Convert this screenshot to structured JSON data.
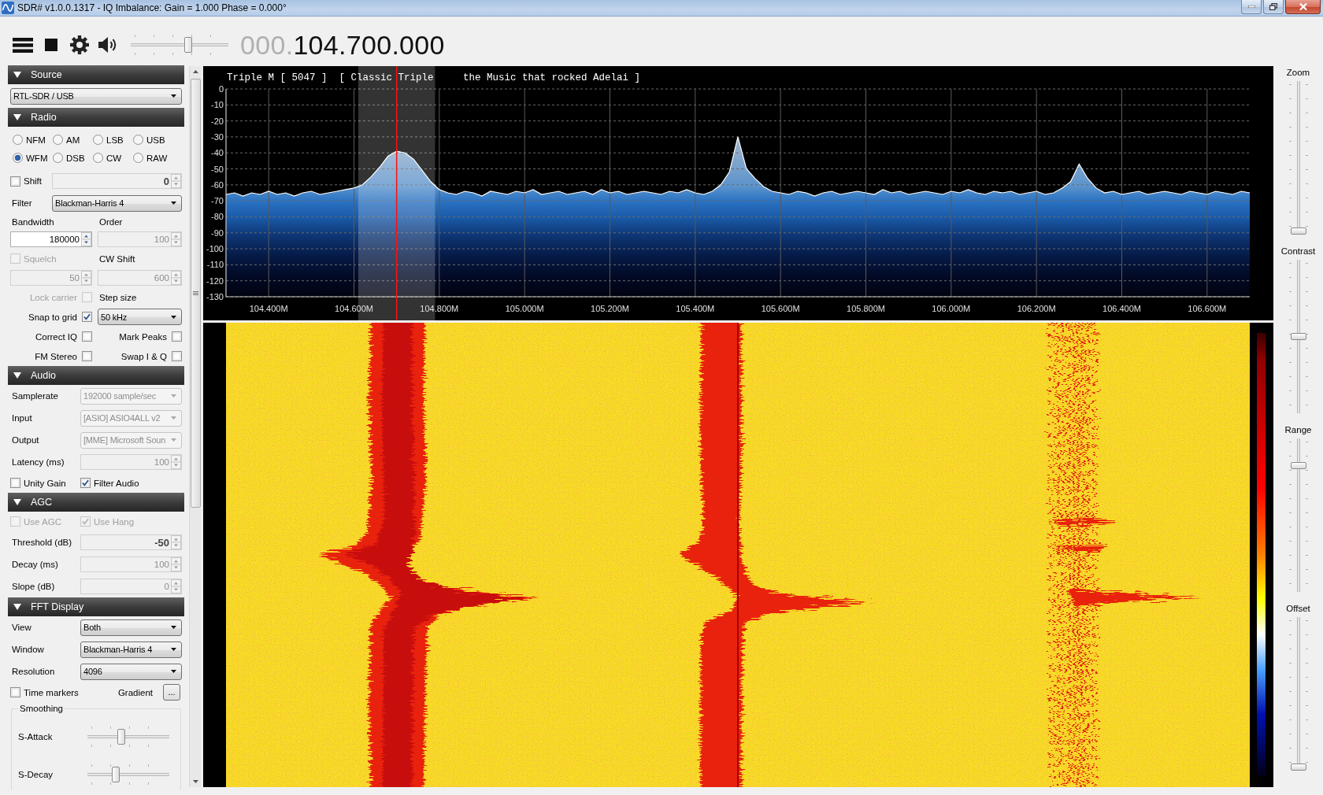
{
  "window": {
    "title": "SDR# v1.0.0.1317 - IQ Imbalance: Gain = 1.000 Phase = 0.000°"
  },
  "toolbar": {
    "volume": {
      "level": 0.6
    },
    "frequency": {
      "inactive_digits": "000.",
      "digits": "104.700.000"
    }
  },
  "panels": [
    {
      "title": "Source",
      "expanded": true,
      "rows": [
        {
          "kind": "dropdown",
          "value": "RTL-SDR / USB",
          "disabled": false
        }
      ]
    },
    {
      "title": "Radio",
      "expanded": true,
      "rows": [
        {
          "kind": "radios",
          "options": [
            {
              "label": "NFM",
              "selected": false
            },
            {
              "label": "AM",
              "selected": false
            },
            {
              "label": "LSB",
              "selected": false
            },
            {
              "label": "USB",
              "selected": false
            },
            {
              "label": "WFM",
              "selected": true
            },
            {
              "label": "DSB",
              "selected": false
            },
            {
              "label": "CW",
              "selected": false
            },
            {
              "label": "RAW",
              "selected": false
            }
          ]
        },
        {
          "kind": "field",
          "lead": {
            "kind": "checkbox",
            "label": "Shift",
            "checked": false,
            "disabled": false
          },
          "field": {
            "kind": "spinner",
            "value": "0",
            "bold": true,
            "disabled": true
          }
        },
        {
          "kind": "field",
          "lead": {
            "kind": "label",
            "text": "Filter"
          },
          "field": {
            "kind": "dropdown",
            "value": "Blackman-Harris 4",
            "disabled": false
          }
        },
        {
          "kind": "pair",
          "cells": [
            {
              "kind": "label",
              "text": "Bandwidth"
            },
            {
              "kind": "label",
              "text": "Order"
            }
          ]
        },
        {
          "kind": "pair",
          "cells": [
            {
              "kind": "spinner",
              "value": "180000",
              "bold": false,
              "disabled": false
            },
            {
              "kind": "spinner",
              "value": "100",
              "bold": false,
              "disabled": true
            }
          ]
        },
        {
          "kind": "pair",
          "cells": [
            {
              "kind": "checkbox",
              "label": "Squelch",
              "checked": false,
              "disabled": true
            },
            {
              "kind": "label",
              "text": "CW Shift"
            }
          ]
        },
        {
          "kind": "pair",
          "cells": [
            {
              "kind": "spinner",
              "value": "50",
              "bold": false,
              "disabled": true
            },
            {
              "kind": "spinner",
              "value": "600",
              "bold": false,
              "disabled": true
            }
          ]
        },
        {
          "kind": "pair",
          "cells": [
            {
              "kind": "checkbox_right",
              "label": "Lock carrier",
              "checked": false,
              "disabled": true
            },
            {
              "kind": "label",
              "text": "Step size"
            }
          ]
        },
        {
          "kind": "pair",
          "cells": [
            {
              "kind": "checkbox_right",
              "label": "Snap to grid",
              "checked": true,
              "disabled": false
            },
            {
              "kind": "dropdown",
              "value": "50 kHz",
              "disabled": false
            }
          ]
        },
        {
          "kind": "pair",
          "cells": [
            {
              "kind": "checkbox_right",
              "label": "Correct IQ",
              "checked": false,
              "disabled": false
            },
            {
              "kind": "checkbox_right",
              "label": "Mark Peaks",
              "checked": false,
              "disabled": false
            }
          ]
        },
        {
          "kind": "pair",
          "cells": [
            {
              "kind": "checkbox_right",
              "label": "FM Stereo",
              "checked": false,
              "disabled": false
            },
            {
              "kind": "checkbox_right",
              "label": "Swap I & Q",
              "checked": false,
              "disabled": false
            }
          ]
        }
      ]
    },
    {
      "title": "Audio",
      "expanded": true,
      "rows": [
        {
          "kind": "field",
          "lead": {
            "kind": "label",
            "text": "Samplerate"
          },
          "field": {
            "kind": "dropdown",
            "value": "192000 sample/sec",
            "disabled": true
          }
        },
        {
          "kind": "field",
          "lead": {
            "kind": "label",
            "text": "Input"
          },
          "field": {
            "kind": "dropdown",
            "value": "[ASIO] ASIO4ALL v2",
            "disabled": true
          }
        },
        {
          "kind": "field",
          "lead": {
            "kind": "label",
            "text": "Output"
          },
          "field": {
            "kind": "dropdown",
            "value": "[MME] Microsoft Soun",
            "disabled": true
          }
        },
        {
          "kind": "field",
          "lead": {
            "kind": "label",
            "text": "Latency (ms)"
          },
          "field": {
            "kind": "spinner",
            "value": "100",
            "bold": false,
            "disabled": true
          }
        },
        {
          "kind": "pair",
          "cells": [
            {
              "kind": "checkbox",
              "label": "Unity Gain",
              "checked": false,
              "disabled": false
            },
            {
              "kind": "checkbox",
              "label": "Filter Audio",
              "checked": true,
              "disabled": false
            }
          ]
        }
      ]
    },
    {
      "title": "AGC",
      "expanded": true,
      "rows": [
        {
          "kind": "pair",
          "cells": [
            {
              "kind": "checkbox",
              "label": "Use AGC",
              "checked": false,
              "disabled": true
            },
            {
              "kind": "checkbox",
              "label": "Use Hang",
              "checked": true,
              "disabled": true
            }
          ]
        },
        {
          "kind": "field",
          "lead": {
            "kind": "label",
            "text": "Threshold (dB)"
          },
          "field": {
            "kind": "spinner",
            "value": "-50",
            "bold": true,
            "disabled": true
          }
        },
        {
          "kind": "field",
          "lead": {
            "kind": "label",
            "text": "Decay (ms)"
          },
          "field": {
            "kind": "spinner",
            "value": "100",
            "bold": false,
            "disabled": true
          }
        },
        {
          "kind": "field",
          "lead": {
            "kind": "label",
            "text": "Slope (dB)"
          },
          "field": {
            "kind": "spinner",
            "value": "0",
            "bold": false,
            "disabled": true
          }
        }
      ]
    },
    {
      "title": "FFT Display",
      "expanded": true,
      "rows": [
        {
          "kind": "field",
          "lead": {
            "kind": "label",
            "text": "View"
          },
          "field": {
            "kind": "dropdown",
            "value": "Both",
            "disabled": false
          }
        },
        {
          "kind": "field",
          "lead": {
            "kind": "label",
            "text": "Window"
          },
          "field": {
            "kind": "dropdown",
            "value": "Blackman-Harris 4",
            "disabled": false
          }
        },
        {
          "kind": "field",
          "lead": {
            "kind": "label",
            "text": "Resolution"
          },
          "field": {
            "kind": "dropdown",
            "value": "4096",
            "disabled": false
          }
        },
        {
          "kind": "pair",
          "cells": [
            {
              "kind": "checkbox",
              "label": "Time markers",
              "checked": false,
              "disabled": false
            },
            {
              "kind": "button_field",
              "label": "Gradient",
              "button": "..."
            }
          ]
        },
        {
          "kind": "group",
          "title": "Smoothing",
          "sliders": [
            {
              "label": "S-Attack",
              "level": 0.4
            },
            {
              "label": "S-Decay",
              "level": 0.33
            }
          ]
        }
      ]
    }
  ],
  "spectrum": {
    "rds_text": "Triple M [ 5047 ]  [ Classic Triple     the Music that rocked Adelai ]",
    "chart_data": {
      "type": "line",
      "grid": true,
      "x": [
        104.3,
        104.32,
        104.34,
        104.36,
        104.38,
        104.4,
        104.42,
        104.44,
        104.46,
        104.48,
        104.5,
        104.52,
        104.54,
        104.56,
        104.58,
        104.6,
        104.62,
        104.64,
        104.66,
        104.68,
        104.7,
        104.72,
        104.74,
        104.76,
        104.78,
        104.8,
        104.82,
        104.84,
        104.86,
        104.88,
        104.9,
        104.92,
        104.94,
        104.96,
        104.98,
        105,
        105.02,
        105.04,
        105.06,
        105.08,
        105.1,
        105.12,
        105.14,
        105.16,
        105.18,
        105.2,
        105.22,
        105.24,
        105.26,
        105.28,
        105.3,
        105.32,
        105.34,
        105.36,
        105.38,
        105.4,
        105.42,
        105.44,
        105.46,
        105.48,
        105.5,
        105.52,
        105.54,
        105.56,
        105.58,
        105.6,
        105.62,
        105.64,
        105.66,
        105.68,
        105.7,
        105.72,
        105.74,
        105.76,
        105.78,
        105.8,
        105.82,
        105.84,
        105.86,
        105.88,
        105.9,
        105.92,
        105.94,
        105.96,
        105.98,
        106,
        106.02,
        106.04,
        106.06,
        106.08,
        106.1,
        106.12,
        106.14,
        106.16,
        106.18,
        106.2,
        106.22,
        106.24,
        106.26,
        106.28,
        106.3,
        106.32,
        106.34,
        106.36,
        106.38,
        106.4,
        106.42,
        106.44,
        106.46,
        106.48,
        106.5,
        106.52,
        106.54,
        106.56,
        106.58,
        106.6,
        106.62,
        106.64,
        106.66,
        106.68,
        106.7
      ],
      "values": [
        -66,
        -65,
        -67,
        -65,
        -66,
        -64,
        -66,
        -65,
        -67,
        -65,
        -64,
        -66,
        -65,
        -64,
        -63,
        -62,
        -60,
        -55,
        -49,
        -42,
        -39,
        -40,
        -44,
        -51,
        -58,
        -63,
        -65,
        -66,
        -64,
        -65,
        -67,
        -64,
        -65,
        -66,
        -64,
        -65,
        -63,
        -66,
        -65,
        -64,
        -66,
        -65,
        -64,
        -66,
        -63,
        -65,
        -64,
        -66,
        -65,
        -64,
        -65,
        -66,
        -64,
        -65,
        -63,
        -65,
        -66,
        -64,
        -60,
        -52,
        -30,
        -50,
        -56,
        -61,
        -64,
        -65,
        -66,
        -64,
        -65,
        -67,
        -65,
        -64,
        -66,
        -65,
        -64,
        -65,
        -66,
        -63,
        -65,
        -64,
        -66,
        -65,
        -64,
        -65,
        -66,
        -64,
        -65,
        -63,
        -65,
        -66,
        -64,
        -65,
        -64,
        -66,
        -65,
        -64,
        -66,
        -65,
        -62,
        -58,
        -47,
        -56,
        -62,
        -65,
        -64,
        -66,
        -65,
        -64,
        -66,
        -65,
        -64,
        -65,
        -66,
        -64,
        -65,
        -66,
        -64,
        -65,
        -66,
        -64,
        -65
      ],
      "xlim": [
        104.3,
        106.7
      ],
      "ylim": [
        -130,
        0
      ],
      "xticks": [
        {
          "value": 104.4,
          "label": "104.400M"
        },
        {
          "value": 104.6,
          "label": "104.600M"
        },
        {
          "value": 104.8,
          "label": "104.800M"
        },
        {
          "value": 105,
          "label": "105.000M"
        },
        {
          "value": 105.2,
          "label": "105.200M"
        },
        {
          "value": 105.4,
          "label": "105.400M"
        },
        {
          "value": 105.6,
          "label": "105.600M"
        },
        {
          "value": 105.8,
          "label": "105.800M"
        },
        {
          "value": 106,
          "label": "106.000M"
        },
        {
          "value": 106.2,
          "label": "106.200M"
        },
        {
          "value": 106.4,
          "label": "106.400M"
        },
        {
          "value": 106.6,
          "label": "106.600M"
        }
      ],
      "yticks": [
        0,
        -10,
        -20,
        -30,
        -40,
        -50,
        -60,
        -70,
        -80,
        -90,
        -100,
        -110,
        -120,
        -130
      ],
      "bands": [
        {
          "axis": "x",
          "from": 104.61,
          "to": 104.79
        }
      ],
      "ref_lines": [
        {
          "axis": "x",
          "value": 104.7
        }
      ]
    }
  },
  "view_controls": [
    {
      "label": "Zoom",
      "level": 0
    },
    {
      "label": "Contrast",
      "level": 0.5
    },
    {
      "label": "Range",
      "level": 0.84
    },
    {
      "label": "Offset",
      "level": 0
    }
  ]
}
